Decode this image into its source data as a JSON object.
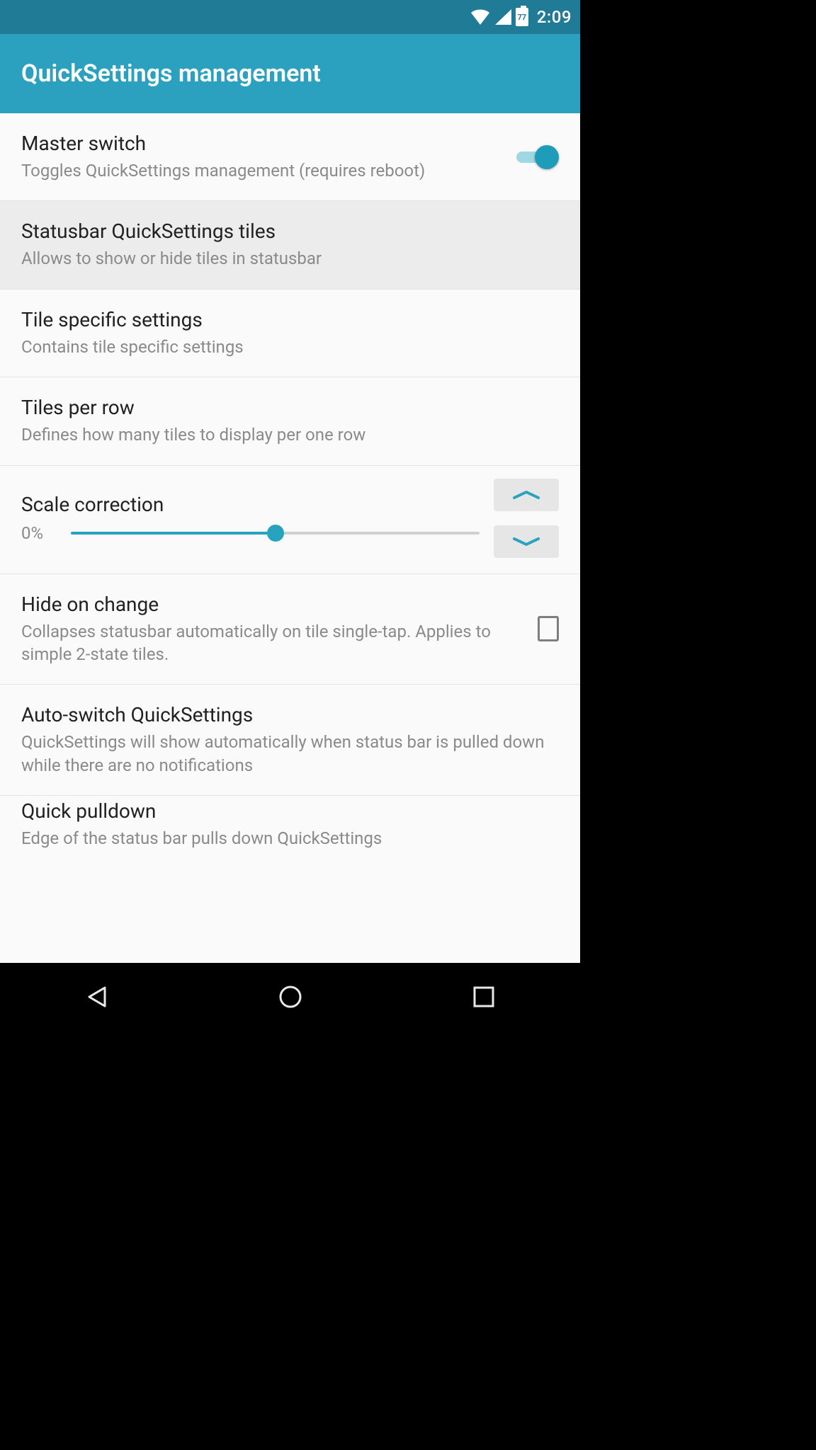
{
  "status_bar": {
    "battery_pct": "77",
    "clock": "2:09"
  },
  "app_bar": {
    "title": "QuickSettings management"
  },
  "colors": {
    "accent": "#27a3c0",
    "status_bg": "#1f7b96",
    "appbar_bg": "#2ca1bf"
  },
  "rows": {
    "master": {
      "title": "Master switch",
      "sub": "Toggles QuickSettings management (requires reboot)",
      "switch_on": true
    },
    "tiles_statusbar": {
      "title": "Statusbar QuickSettings tiles",
      "sub": "Allows to show or hide tiles in statusbar"
    },
    "tile_specific": {
      "title": "Tile specific settings",
      "sub": "Contains tile specific settings"
    },
    "tiles_per_row": {
      "title": "Tiles per row",
      "sub": "Defines how many tiles to display per one row"
    },
    "scale": {
      "title": "Scale correction",
      "value_label": "0%",
      "slider_percent": 50
    },
    "hide_on_change": {
      "title": "Hide on change",
      "sub": "Collapses statusbar automatically on tile single-tap. Applies to simple 2-state tiles.",
      "checked": false
    },
    "auto_switch": {
      "title": "Auto-switch QuickSettings",
      "sub": "QuickSettings will show automatically when status bar is pulled down while there are no notifications"
    },
    "quick_pulldown": {
      "title": "Quick pulldown",
      "sub": "Edge of the status bar pulls down QuickSettings"
    }
  }
}
